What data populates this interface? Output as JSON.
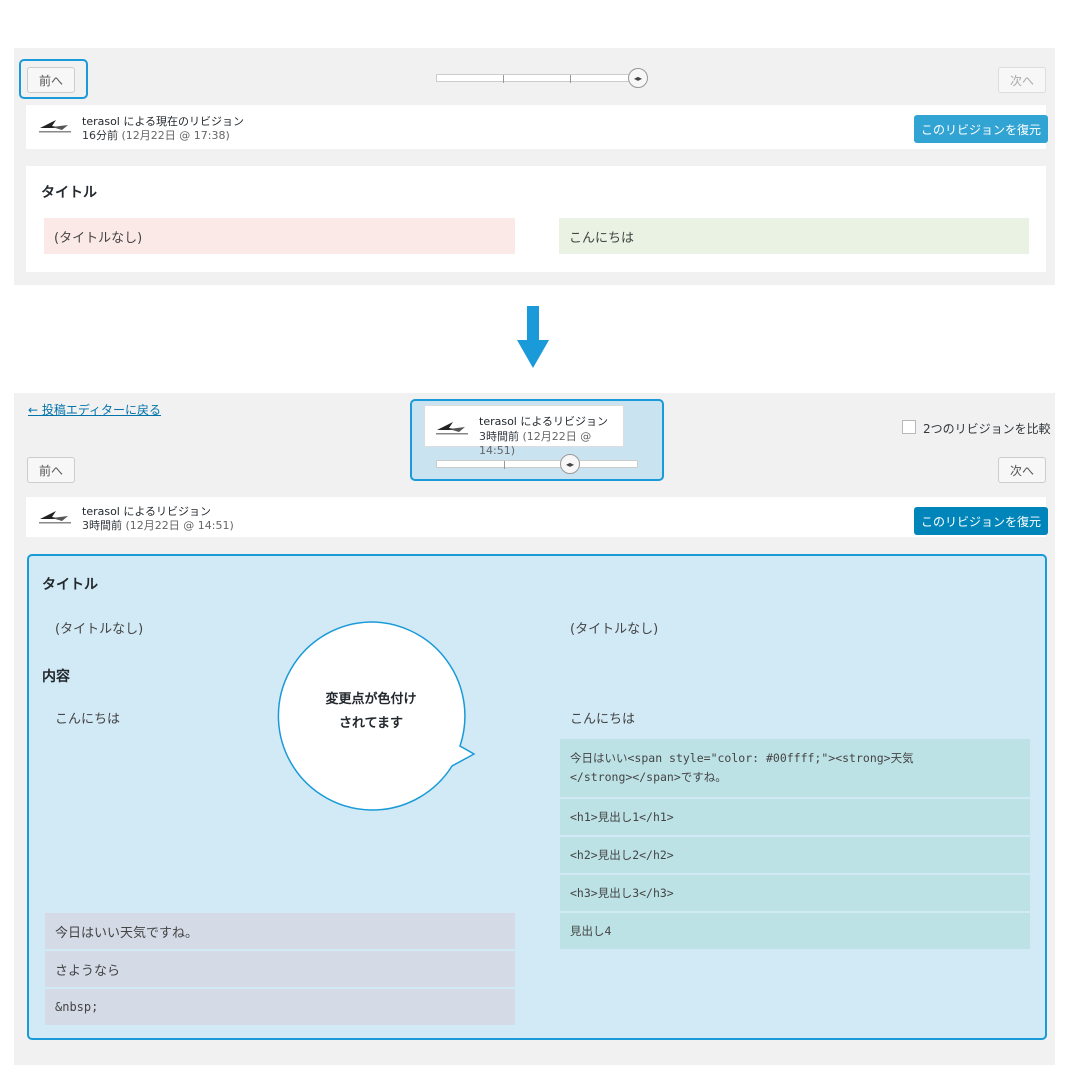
{
  "colors": {
    "accent_blue": "#0085ba",
    "highlight_blue": "#1a9ad8",
    "deleted": "#fbe9e7",
    "added": "#e9f2e3",
    "panel_bg": "#f1f1f1"
  },
  "top": {
    "prev_label": "前へ",
    "next_label": "次へ",
    "author_line": "terasol による現在のリビジョン",
    "date_rel": "16分前",
    "date_abs": "(12月22日 @ 17:38)",
    "restore_label": "このリビジョンを復元",
    "section_title": "タイトル",
    "title_old": "(タイトルなし)",
    "title_new": "こんにちは"
  },
  "bottom": {
    "back_link": "← 投稿エディターに戻る",
    "compare_label": "2つのリビジョンを比較",
    "tooltip_author": "terasol によるリビジョン",
    "tooltip_date_rel": "3時間前",
    "tooltip_date_abs": "(12月22日 @ 14:51)",
    "prev_label": "前へ",
    "next_label": "次へ",
    "author_line": "terasol によるリビジョン",
    "date_rel": "3時間前",
    "date_abs": "(12月22日 @ 14:51)",
    "restore_label": "このリビジョンを復元",
    "title_heading": "タイトル",
    "title_left": "(タイトルなし)",
    "title_right": "(タイトルなし)",
    "content_heading": "内容",
    "content_left_1": "こんにちは",
    "content_right_1": "こんにちは",
    "content_right_added": [
      "今日はいい<span style=\"color: #00ffff;\"><strong>天気",
      "</strong></span>ですね。",
      "<h1>見出し1</h1>",
      "<h2>見出し2</h2>",
      "<h3>見出し3</h3>",
      "見出し4"
    ],
    "content_left_deleted": [
      "今日はいい天気ですね。",
      "さようなら",
      "&nbsp;"
    ],
    "callout_line1": "変更点が色付け",
    "callout_line2": "されてます"
  }
}
